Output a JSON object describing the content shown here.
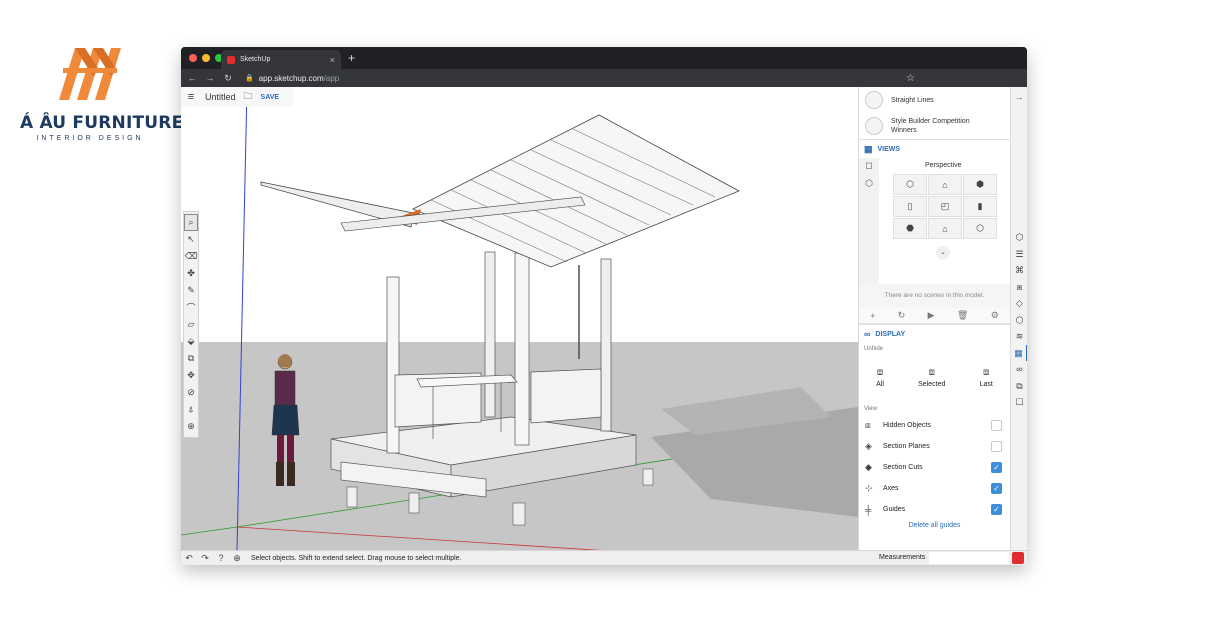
{
  "logo": {
    "title": "Á ÂU FURNITURE",
    "subtitle": "INTERIOR DESIGN",
    "colors": {
      "orange": "#f0893a",
      "navy": "#1e3a5f"
    }
  },
  "browser": {
    "tab_title": "SketchUp",
    "url_host": "app.sketchup.com",
    "url_path": "/app",
    "new_tab": "+",
    "close": "×"
  },
  "app": {
    "doc_title": "Untitled",
    "save_label": "SAVE"
  },
  "status": {
    "hint": "Select objects. Shift to extend select. Drag mouse to select multiple.",
    "measurements_label": "Measurements"
  },
  "panel": {
    "styles": [
      {
        "label": "Straight Lines"
      },
      {
        "label": "Style Builder Competition Winners"
      }
    ],
    "views": {
      "header": "VIEWS",
      "perspective_label": "Perspective",
      "no_scenes": "There are no scenes in this model."
    },
    "display": {
      "header": "DISPLAY",
      "unhide_label": "Unhide",
      "unhide": [
        {
          "label": "All"
        },
        {
          "label": "Selected"
        },
        {
          "label": "Last"
        }
      ],
      "view_label": "View",
      "toggles": [
        {
          "label": "Hidden Objects",
          "checked": false
        },
        {
          "label": "Section Planes",
          "checked": false
        },
        {
          "label": "Section Cuts",
          "checked": true
        },
        {
          "label": "Axes",
          "checked": true
        },
        {
          "label": "Guides",
          "checked": true
        }
      ],
      "delete_guides": "Delete all guides"
    }
  }
}
